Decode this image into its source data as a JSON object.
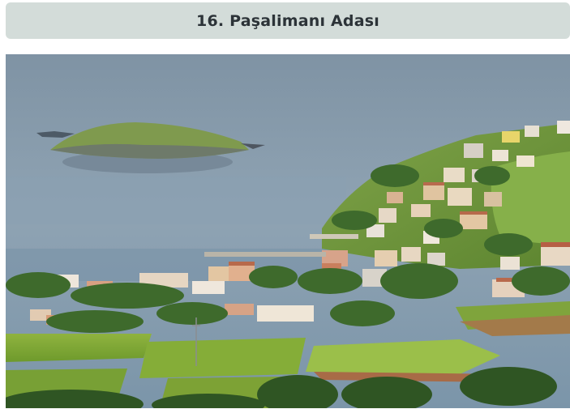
{
  "header": {
    "title": "16. Paşalimanı Adası"
  },
  "photo": {
    "subject": "island-village-coastline-photo"
  }
}
